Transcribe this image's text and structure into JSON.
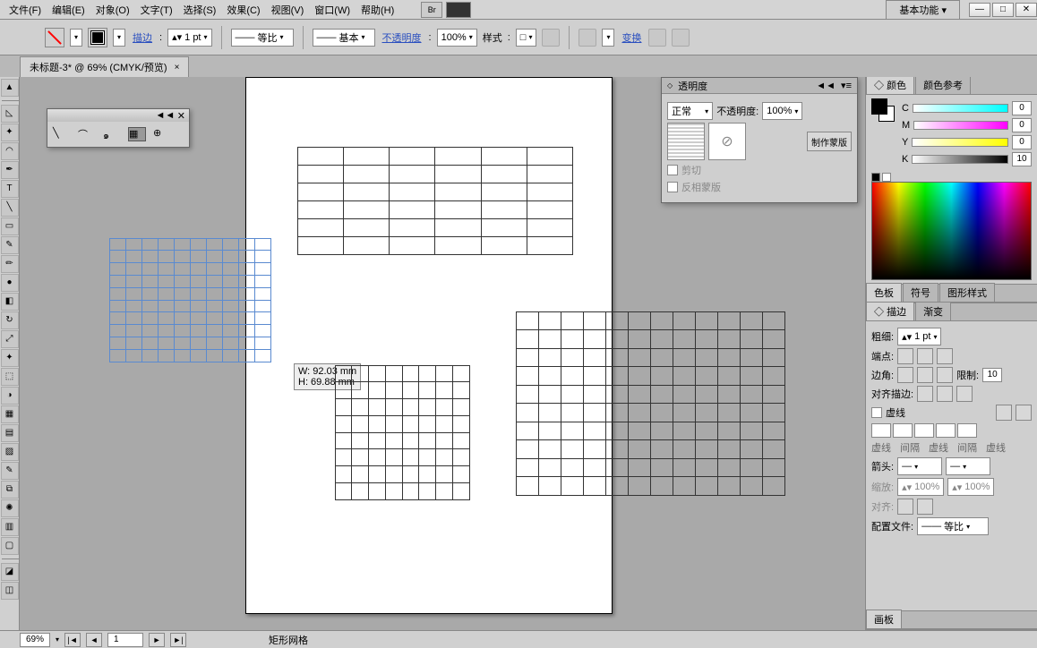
{
  "menu": {
    "file": "文件(F)",
    "edit": "编辑(E)",
    "object": "对象(O)",
    "type": "文字(T)",
    "select": "选择(S)",
    "effect": "效果(C)",
    "view": "视图(V)",
    "window": "窗口(W)",
    "help": "帮助(H)",
    "br": "Br"
  },
  "workspace": {
    "name": "基本功能",
    "caret": "▾"
  },
  "win": {
    "min": "—",
    "max": "□",
    "close": "✕"
  },
  "optbar": {
    "stroke_link": "描边",
    "stroke_val": "1 pt",
    "dash": "等比",
    "profile": "基本",
    "opacity_link": "不透明度",
    "opacity_val": "100%",
    "style": "样式",
    "transform": "变换"
  },
  "doctab": {
    "title": "未标题-3* @ 69% (CMYK/预览)",
    "x": "×"
  },
  "mini": {
    "collapse": "◄◄",
    "close": "✕"
  },
  "measure": {
    "w": "W: 92.03 mm",
    "h": "H: 69.88 mm"
  },
  "transp": {
    "title": "透明度",
    "mode": "正常",
    "opacity_label": "不透明度:",
    "opacity_val": "100%",
    "make_mask": "制作蒙版",
    "clip": "剪切",
    "invert": "反相蒙版",
    "collapse": "◄◄",
    "menu": "▾≡"
  },
  "color": {
    "tab1": "颜色",
    "tab2": "颜色参考",
    "c": "C",
    "m": "M",
    "y": "Y",
    "k": "K",
    "val": "0",
    "k_val": "10"
  },
  "swatches": {
    "tab1": "色板",
    "tab2": "符号",
    "tab3": "图形样式"
  },
  "stroke": {
    "tab1": "描边",
    "tab2": "渐变",
    "weight": "粗细:",
    "weight_val": "1 pt",
    "cap": "端点:",
    "corner": "边角:",
    "limit": "限制:",
    "limit_val": "10",
    "align": "对齐描边:",
    "dashed": "虚线",
    "dash1": "虚线",
    "gap1": "间隔",
    "dash2": "虚线",
    "gap2": "间隔",
    "dash3": "虚线",
    "arrow": "箭头:",
    "scale": "缩放:",
    "scale_val": "100%",
    "align2": "对齐:",
    "profile": "配置文件:",
    "profile_val": "等比"
  },
  "artboard_panel": {
    "title": "画板"
  },
  "status": {
    "zoom": "69%",
    "page": "1",
    "tool": "矩形网格"
  }
}
